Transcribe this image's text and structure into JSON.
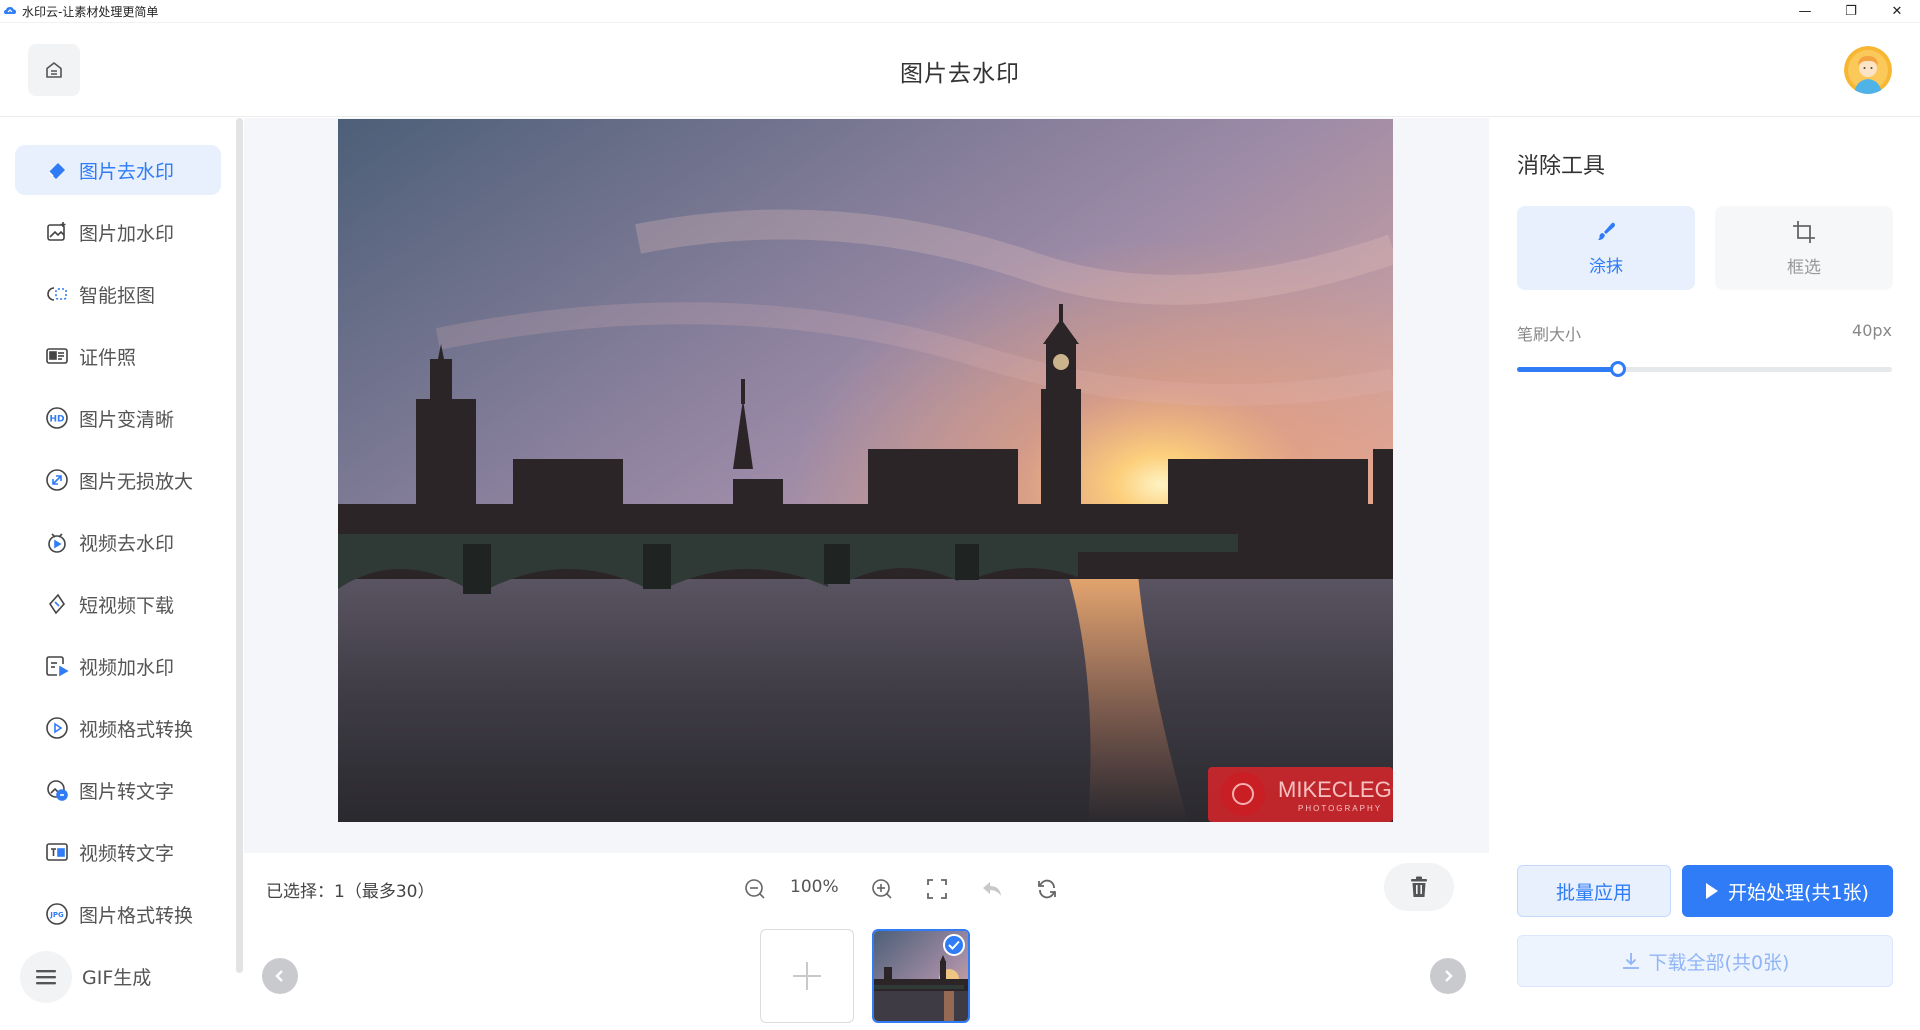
{
  "window": {
    "title": "水印云-让素材处理更简单",
    "minimize_glyph": "—",
    "maximize_glyph": "❐",
    "close_glyph": "✕"
  },
  "header": {
    "title": "图片去水印",
    "home_icon": "home-icon",
    "avatar_icon": "user-avatar"
  },
  "sidebar": {
    "items": [
      {
        "label": "图片去水印",
        "icon": "eraser-icon",
        "active": true
      },
      {
        "label": "图片加水印",
        "icon": "image-add-icon"
      },
      {
        "label": "智能抠图",
        "icon": "cutout-icon"
      },
      {
        "label": "证件照",
        "icon": "id-card-icon"
      },
      {
        "label": "图片变清晰",
        "icon": "hd-icon"
      },
      {
        "label": "图片无损放大",
        "icon": "enlarge-icon"
      },
      {
        "label": "视频去水印",
        "icon": "video-eraser-icon"
      },
      {
        "label": "短视频下载",
        "icon": "link-icon"
      },
      {
        "label": "视频加水印",
        "icon": "video-add-icon"
      },
      {
        "label": "视频格式转换",
        "icon": "play-circle-icon"
      },
      {
        "label": "图片转文字",
        "icon": "image-text-icon"
      },
      {
        "label": "视频转文字",
        "icon": "video-text-icon"
      },
      {
        "label": "图片格式转换",
        "icon": "jpg-icon"
      },
      {
        "label": "GIF生成",
        "icon": "gif-icon"
      }
    ]
  },
  "canvas": {
    "watermark_text": "MIKECLEGG",
    "watermark_sub": "PHOTOGRAPHY"
  },
  "toolbar": {
    "selected_text": "已选择：1（最多30）",
    "zoom_level": "100%"
  },
  "panel": {
    "title": "消除工具",
    "modes": [
      {
        "label": "涂抹",
        "icon": "brush-icon",
        "active": true
      },
      {
        "label": "框选",
        "icon": "crop-icon",
        "active": false
      }
    ],
    "brush_label": "笔刷大小",
    "brush_value": "40px",
    "brush_fraction": 0.27,
    "batch_label": "批量应用",
    "start_label": "开始处理(共1张)",
    "download_label": "下载全部(共0张)"
  },
  "colors": {
    "accent": "#2f7cf6",
    "active_bg": "#e8f0fd"
  }
}
